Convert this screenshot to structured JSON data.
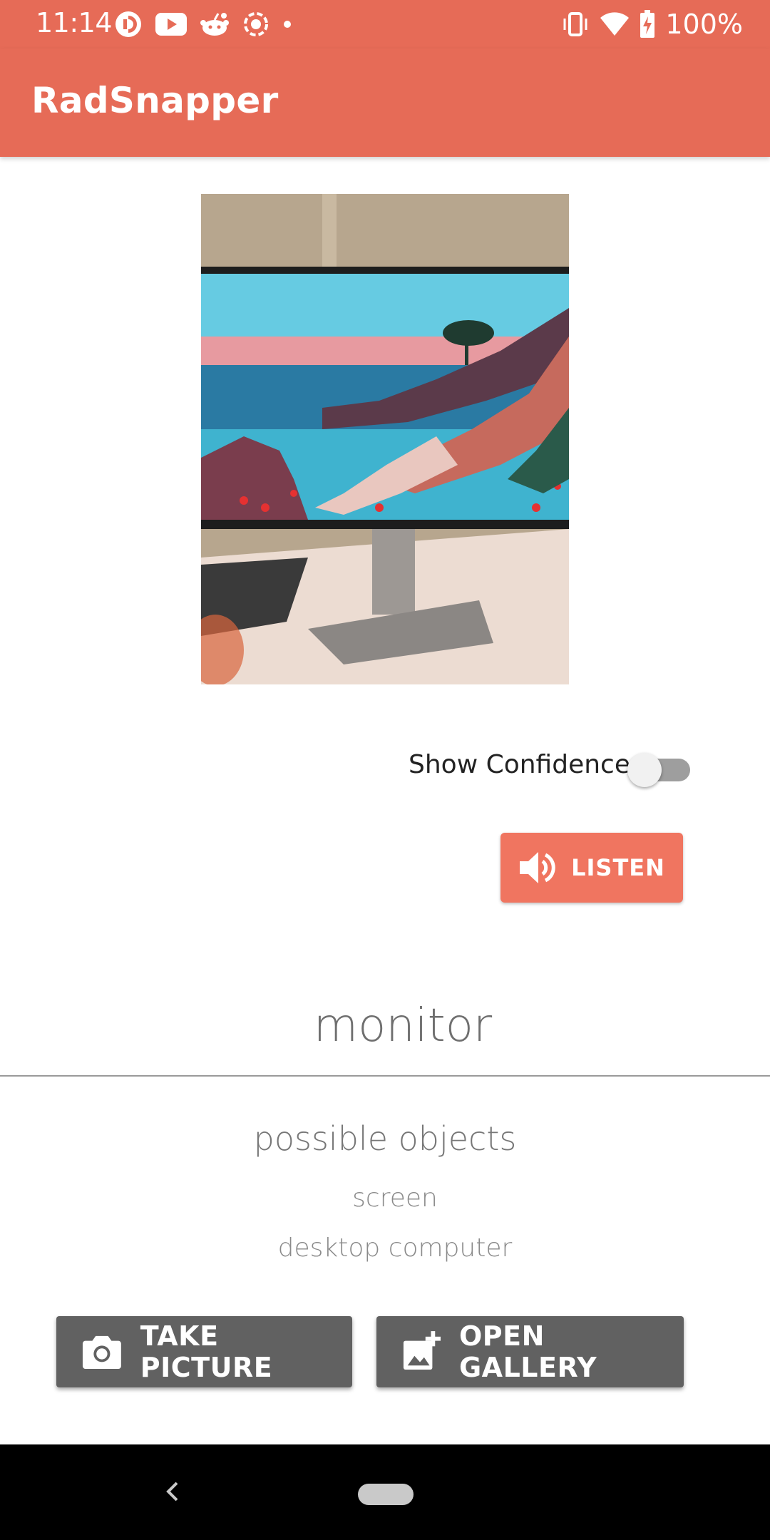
{
  "status_bar": {
    "time": "11:14",
    "battery_percent": "100%",
    "left_icons": [
      "pocketcasts-icon",
      "youtube-icon",
      "reddit-icon",
      "screen-record-icon",
      "dot-icon"
    ],
    "right_icons": [
      "vibrate-icon",
      "wifi-icon",
      "battery-charging-icon"
    ]
  },
  "app_bar": {
    "title": "RadSnapper",
    "color": "#E66B57"
  },
  "photo": {
    "icon": "monitor-photo"
  },
  "confidence_toggle": {
    "label": "Show Confidence",
    "checked": false
  },
  "listen_button": {
    "label": "LISTEN",
    "icon": "speaker-icon",
    "color": "#F07560"
  },
  "result": {
    "label": "monitor"
  },
  "possible_objects": {
    "title": "possible objects",
    "items": [
      "screen",
      "desktop computer"
    ]
  },
  "actions": {
    "take_picture": {
      "label": "TAKE PICTURE",
      "icon": "camera-icon"
    },
    "open_gallery": {
      "label": "OPEN GALLERY",
      "icon": "add-photo-icon"
    }
  },
  "nav_bar": {
    "icons": [
      "back-icon",
      "home-pill-icon"
    ]
  }
}
